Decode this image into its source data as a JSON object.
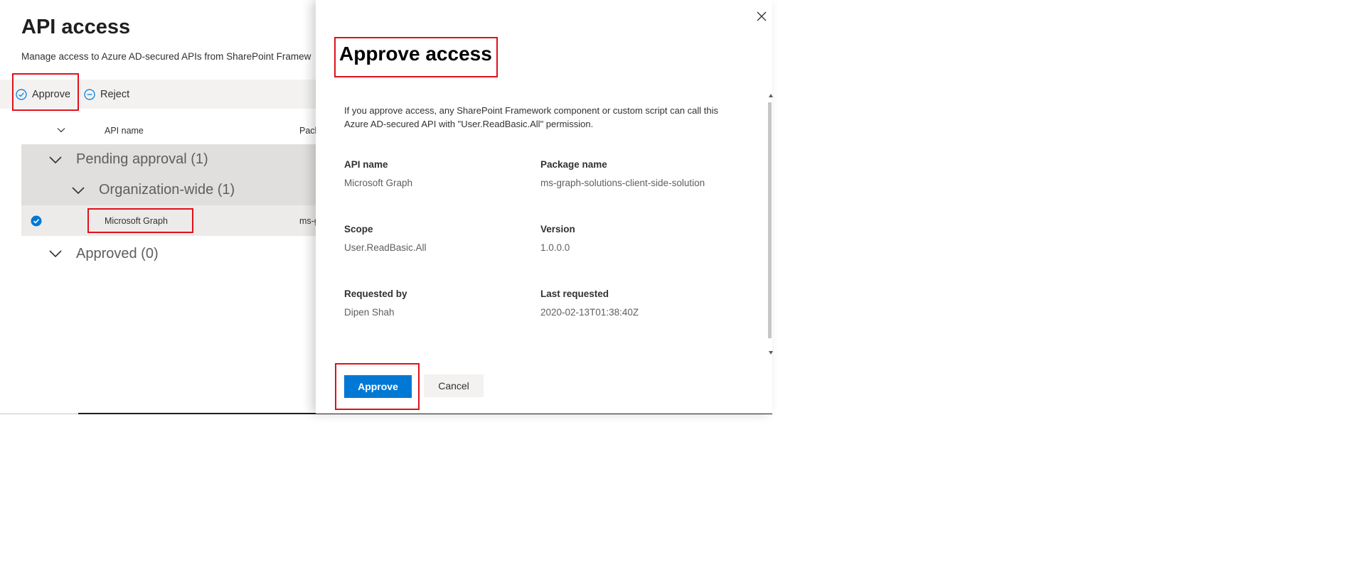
{
  "page": {
    "title": "API access",
    "description": "Manage access to Azure AD-secured APIs from SharePoint Framew"
  },
  "commandbar": {
    "approve_label": "Approve",
    "reject_label": "Reject"
  },
  "table": {
    "columns": [
      "API name",
      "Pack"
    ],
    "groups": [
      {
        "label": "Pending approval (1)"
      },
      {
        "label": "Organization-wide (1)"
      },
      {
        "label": "Approved (0)"
      }
    ],
    "rows": [
      {
        "api_name": "Microsoft Graph",
        "package": "ms-g",
        "selected": true
      }
    ]
  },
  "panel": {
    "title": "Approve access",
    "description": "If you approve access, any SharePoint Framework component or custom script can call this Azure AD-secured API with \"User.ReadBasic.All\" permission.",
    "fields": [
      {
        "label": "API name",
        "value": "Microsoft Graph"
      },
      {
        "label": "Package name",
        "value": "ms-graph-solutions-client-side-solution"
      },
      {
        "label": "Scope",
        "value": "User.ReadBasic.All"
      },
      {
        "label": "Version",
        "value": "1.0.0.0"
      },
      {
        "label": "Requested by",
        "value": "Dipen Shah"
      },
      {
        "label": "Last requested",
        "value": "2020-02-13T01:38:40Z"
      }
    ],
    "approve_label": "Approve",
    "cancel_label": "Cancel"
  },
  "colors": {
    "primary": "#0078d4",
    "annotation": "#e1101b",
    "group_bg": "#e1dfdd",
    "commandbar_bg": "#f3f2f1"
  },
  "icons": [
    "check-circle-icon",
    "minus-circle-icon",
    "chevron-down-icon",
    "checkmark-selected-icon",
    "close-icon"
  ]
}
